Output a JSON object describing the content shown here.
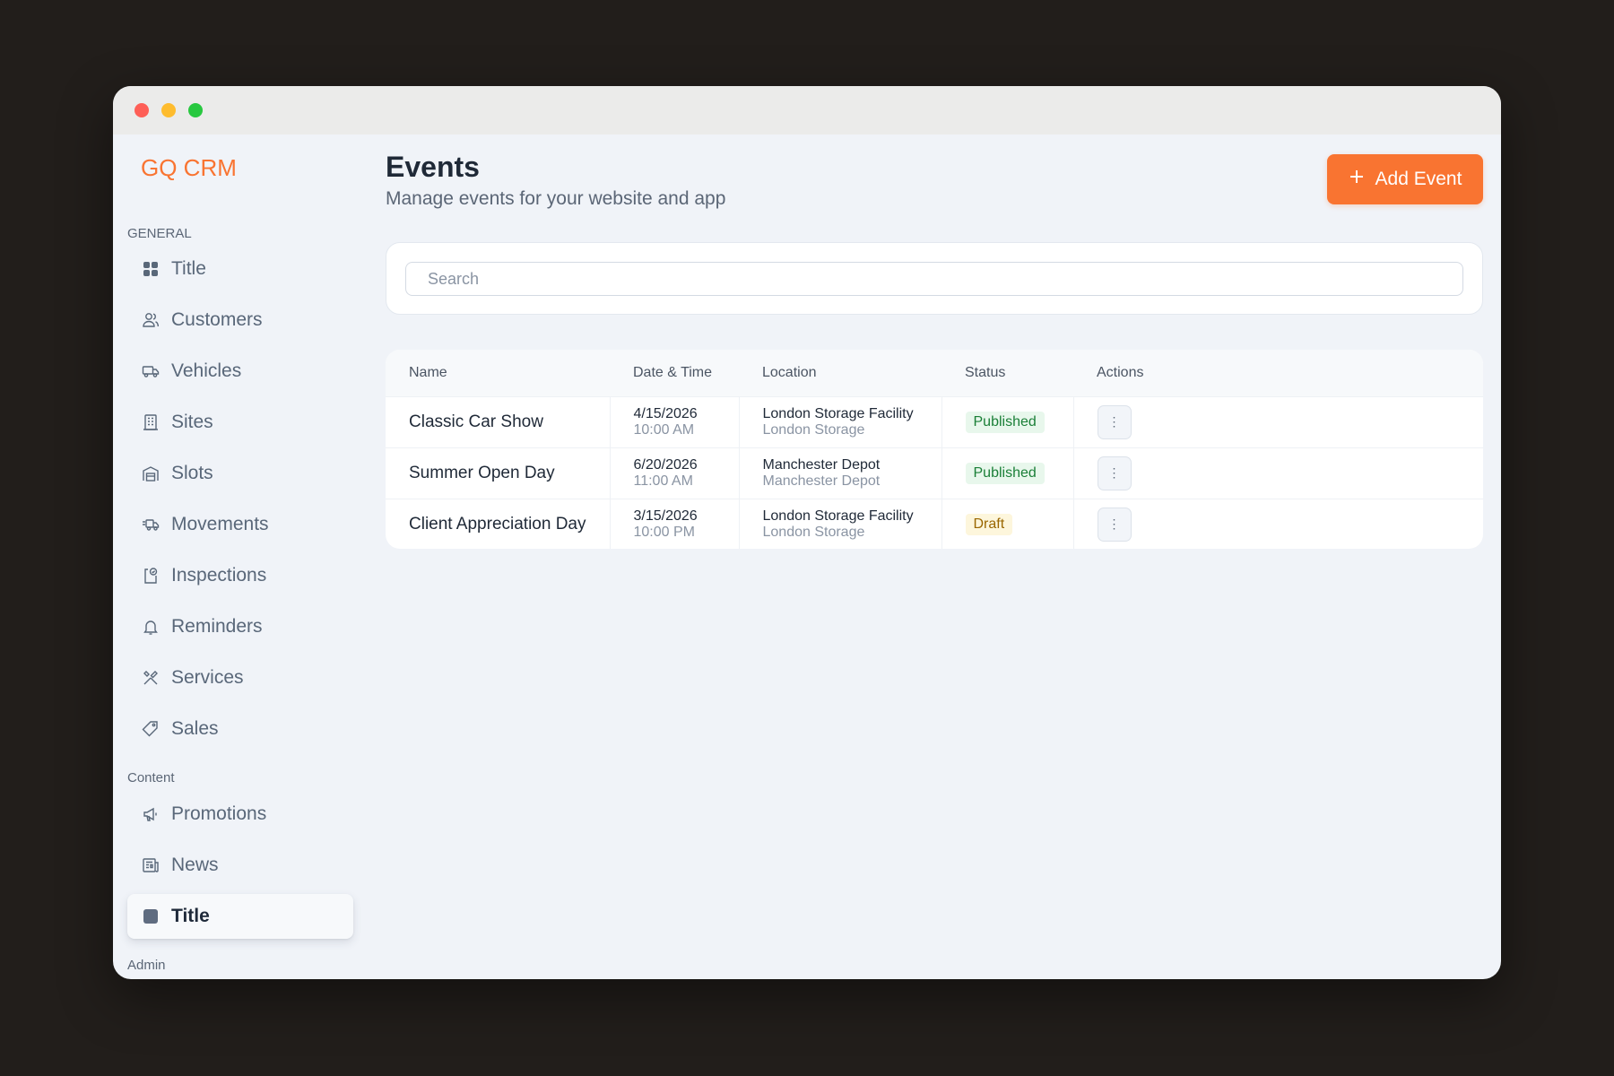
{
  "app": {
    "brand": "GQ CRM"
  },
  "colors": {
    "accent": "#f97431",
    "published": "#1a7f37",
    "draft": "#9a6700"
  },
  "sidebar": {
    "sections": [
      {
        "label": "GENERAL"
      },
      {
        "label": "Content"
      },
      {
        "label": "Admin"
      }
    ],
    "items": [
      {
        "label": "Title",
        "icon": "grid-icon"
      },
      {
        "label": "Customers",
        "icon": "users-icon"
      },
      {
        "label": "Vehicles",
        "icon": "truck-icon"
      },
      {
        "label": "Sites",
        "icon": "building-icon"
      },
      {
        "label": "Slots",
        "icon": "garage-icon"
      },
      {
        "label": "Movements",
        "icon": "moving-truck-icon"
      },
      {
        "label": "Inspections",
        "icon": "clipboard-check-icon"
      },
      {
        "label": "Reminders",
        "icon": "bell-icon"
      },
      {
        "label": "Services",
        "icon": "tools-icon"
      },
      {
        "label": "Sales",
        "icon": "tag-icon"
      },
      {
        "label": "Promotions",
        "icon": "megaphone-icon"
      },
      {
        "label": "News",
        "icon": "newspaper-icon"
      },
      {
        "label": "Title",
        "icon": "square-icon",
        "active": true
      }
    ]
  },
  "header": {
    "title": "Events",
    "subtitle": "Manage events for your website and app",
    "add_button": "Add Event"
  },
  "search": {
    "placeholder": "Search",
    "value": ""
  },
  "table": {
    "columns": [
      "Name",
      "Date & Time",
      "Location",
      "Status",
      "Actions"
    ],
    "rows": [
      {
        "name": "Classic Car Show",
        "date": "4/15/2026",
        "time": "10:00 AM",
        "location": "London Storage Facility",
        "location_sub": "London Storage",
        "status": "Published"
      },
      {
        "name": "Summer Open Day",
        "date": "6/20/2026",
        "time": "11:00 AM",
        "location": "Manchester Depot",
        "location_sub": "Manchester Depot",
        "status": "Published"
      },
      {
        "name": "Client Appreciation Day",
        "date": "3/15/2026",
        "time": "10:00 PM",
        "location": "London Storage Facility",
        "location_sub": "London Storage",
        "status": "Draft"
      }
    ]
  }
}
